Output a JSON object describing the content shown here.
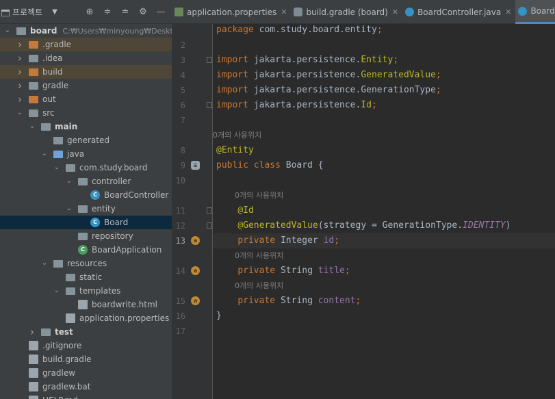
{
  "project_tool": {
    "title": "프로젝트"
  },
  "tabs": [
    {
      "label": "application.properties",
      "icon": "properties-file-icon",
      "active": false
    },
    {
      "label": "build.gradle (board)",
      "icon": "gradle-icon",
      "active": false
    },
    {
      "label": "BoardController.java",
      "icon": "java-class-icon",
      "active": false
    },
    {
      "label": "Board.java",
      "icon": "java-class-icon",
      "active": true
    }
  ],
  "tree": [
    {
      "label": "board",
      "path": "C:₩Users₩minyoung₩Desktop₩study₩board",
      "depth": 0,
      "icon": "module-folder-icon",
      "arrow": "down",
      "bold": true
    },
    {
      "label": ".gradle",
      "depth": 1,
      "icon": "folder-orange-icon",
      "arrow": "right",
      "highlight": true
    },
    {
      "label": ".idea",
      "depth": 1,
      "icon": "folder-icon",
      "arrow": "right"
    },
    {
      "label": "build",
      "depth": 1,
      "icon": "folder-orange-icon",
      "arrow": "right",
      "highlight": true
    },
    {
      "label": "gradle",
      "depth": 1,
      "icon": "folder-icon",
      "arrow": "right"
    },
    {
      "label": "out",
      "depth": 1,
      "icon": "folder-orange-icon",
      "arrow": "right"
    },
    {
      "label": "src",
      "depth": 1,
      "icon": "folder-icon",
      "arrow": "down"
    },
    {
      "label": "main",
      "depth": 2,
      "icon": "folder-icon",
      "arrow": "down",
      "bold": true
    },
    {
      "label": "generated",
      "depth": 3,
      "icon": "generated-folder-icon",
      "arrow": ""
    },
    {
      "label": "java",
      "depth": 3,
      "icon": "folder-blue-icon",
      "arrow": "down"
    },
    {
      "label": "com.study.board",
      "depth": 4,
      "icon": "package-icon",
      "arrow": "down"
    },
    {
      "label": "controller",
      "depth": 5,
      "icon": "package-icon",
      "arrow": "down"
    },
    {
      "label": "BoardController",
      "depth": 6,
      "icon": "java-class-icon",
      "arrow": ""
    },
    {
      "label": "entity",
      "depth": 5,
      "icon": "package-icon",
      "arrow": "down"
    },
    {
      "label": "Board",
      "depth": 6,
      "icon": "java-class-icon",
      "arrow": "",
      "selected": true
    },
    {
      "label": "repository",
      "depth": 5,
      "icon": "package-icon",
      "arrow": ""
    },
    {
      "label": "BoardApplication",
      "depth": 5,
      "icon": "spring-class-icon",
      "arrow": ""
    },
    {
      "label": "resources",
      "depth": 3,
      "icon": "resources-folder-icon",
      "arrow": "down"
    },
    {
      "label": "static",
      "depth": 4,
      "icon": "folder-icon",
      "arrow": ""
    },
    {
      "label": "templates",
      "depth": 4,
      "icon": "folder-icon",
      "arrow": "down"
    },
    {
      "label": "boardwrite.html",
      "depth": 5,
      "icon": "html-file-icon",
      "arrow": ""
    },
    {
      "label": "application.properties",
      "depth": 4,
      "icon": "properties-file-icon",
      "arrow": ""
    },
    {
      "label": "test",
      "depth": 2,
      "icon": "folder-icon",
      "arrow": "right",
      "bold": true
    },
    {
      "label": ".gitignore",
      "depth": 1,
      "icon": "gitignore-file-icon",
      "arrow": ""
    },
    {
      "label": "build.gradle",
      "depth": 1,
      "icon": "gradle-icon",
      "arrow": ""
    },
    {
      "label": "gradlew",
      "depth": 1,
      "icon": "file-icon",
      "arrow": ""
    },
    {
      "label": "gradlew.bat",
      "depth": 1,
      "icon": "file-icon",
      "arrow": ""
    },
    {
      "label": "HELP.md",
      "depth": 1,
      "icon": "file-icon",
      "arrow": ""
    }
  ],
  "editor": {
    "current_line": "13",
    "usage_hint": "0개의 사용위치",
    "lines": [
      {
        "num": "",
        "tokens": [
          {
            "t": "package ",
            "c": "kw"
          },
          {
            "t": "com.study.board.entity",
            "c": "plain"
          },
          {
            "t": ";",
            "c": "kw"
          }
        ]
      },
      {
        "num": "2",
        "tokens": []
      },
      {
        "num": "3",
        "fold": true,
        "tokens": [
          {
            "t": "import ",
            "c": "kw"
          },
          {
            "t": "jakarta.persistence.",
            "c": "plain"
          },
          {
            "t": "Entity",
            "c": "ann"
          },
          {
            "t": ";",
            "c": "kw"
          }
        ]
      },
      {
        "num": "4",
        "tokens": [
          {
            "t": "import ",
            "c": "kw"
          },
          {
            "t": "jakarta.persistence.",
            "c": "plain"
          },
          {
            "t": "GeneratedValue",
            "c": "ann"
          },
          {
            "t": ";",
            "c": "kw"
          }
        ]
      },
      {
        "num": "5",
        "tokens": [
          {
            "t": "import ",
            "c": "kw"
          },
          {
            "t": "jakarta.persistence.GenerationType",
            "c": "plain"
          },
          {
            "t": ";",
            "c": "kw"
          }
        ]
      },
      {
        "num": "6",
        "fold": true,
        "tokens": [
          {
            "t": "import ",
            "c": "kw"
          },
          {
            "t": "jakarta.persistence.",
            "c": "plain"
          },
          {
            "t": "Id",
            "c": "ann"
          },
          {
            "t": ";",
            "c": "kw"
          }
        ]
      },
      {
        "num": "7",
        "tokens": []
      },
      {
        "num": "",
        "hint": true,
        "indent": 0,
        "tokens": []
      },
      {
        "num": "8",
        "tokens": [
          {
            "t": "@Entity",
            "c": "ann"
          }
        ]
      },
      {
        "num": "9",
        "mark": "db",
        "tokens": [
          {
            "t": "public class ",
            "c": "kw"
          },
          {
            "t": "Board {",
            "c": "plain"
          }
        ]
      },
      {
        "num": "10",
        "tokens": []
      },
      {
        "num": "",
        "hint": true,
        "indent": 1,
        "tokens": []
      },
      {
        "num": "11",
        "fold": true,
        "tokens": [
          {
            "t": "    ",
            "c": "plain"
          },
          {
            "t": "@Id",
            "c": "ann"
          }
        ]
      },
      {
        "num": "12",
        "fold": true,
        "tokens": [
          {
            "t": "    ",
            "c": "plain"
          },
          {
            "t": "@GeneratedValue",
            "c": "ann"
          },
          {
            "t": "(strategy = GenerationType.",
            "c": "plain"
          },
          {
            "t": "IDENTITY",
            "c": "fld-i"
          },
          {
            "t": ")",
            "c": "plain"
          }
        ]
      },
      {
        "num": "13",
        "current": true,
        "mark": "field",
        "tokens": [
          {
            "t": "    ",
            "c": "plain"
          },
          {
            "t": "private ",
            "c": "kw"
          },
          {
            "t": "Integer ",
            "c": "plain"
          },
          {
            "t": "id",
            "c": "fld"
          },
          {
            "t": ";",
            "c": "kw"
          }
        ]
      },
      {
        "num": "",
        "hint": true,
        "indent": 1,
        "tokens": []
      },
      {
        "num": "14",
        "mark": "field",
        "tokens": [
          {
            "t": "    ",
            "c": "plain"
          },
          {
            "t": "private ",
            "c": "kw"
          },
          {
            "t": "String ",
            "c": "plain"
          },
          {
            "t": "title",
            "c": "fld"
          },
          {
            "t": ";",
            "c": "kw"
          }
        ]
      },
      {
        "num": "",
        "hint": true,
        "indent": 1,
        "tokens": []
      },
      {
        "num": "15",
        "mark": "field",
        "tokens": [
          {
            "t": "    ",
            "c": "plain"
          },
          {
            "t": "private ",
            "c": "kw"
          },
          {
            "t": "String ",
            "c": "plain"
          },
          {
            "t": "content",
            "c": "fld"
          },
          {
            "t": ";",
            "c": "kw"
          }
        ]
      },
      {
        "num": "16",
        "tokens": [
          {
            "t": "}",
            "c": "plain"
          }
        ]
      },
      {
        "num": "17",
        "tokens": []
      }
    ]
  },
  "colors": {
    "accent": "#4a88c7",
    "keyword": "#cc7832",
    "annotation": "#bbb529",
    "field": "#9876aa"
  }
}
